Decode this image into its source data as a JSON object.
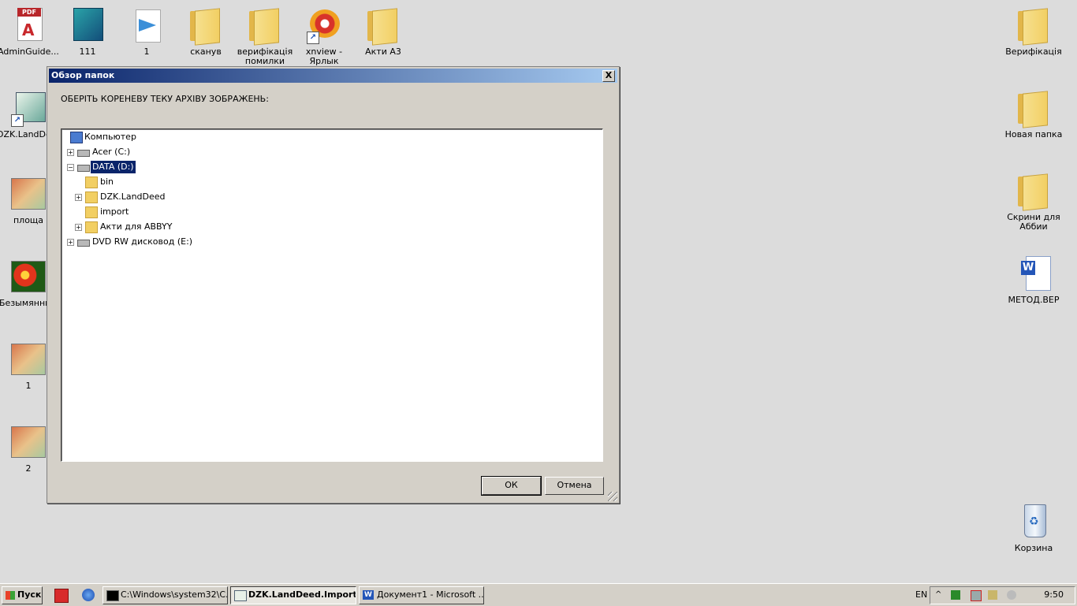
{
  "desktop": {
    "icons": [
      {
        "label": "AdminGuide...",
        "icon": "pdf-icon"
      },
      {
        "label": "111",
        "icon": "app-icon"
      },
      {
        "label": "1",
        "icon": "paper-plane-icon"
      },
      {
        "label": "сканув",
        "icon": "folder-icon"
      },
      {
        "label": "верифікація помилки",
        "icon": "folder-icon"
      },
      {
        "label": "xnview - Ярлык",
        "icon": "xnview-icon"
      },
      {
        "label": "Акти А3",
        "icon": "folder-icon"
      },
      {
        "label": "Верифікація",
        "icon": "folder-icon"
      },
      {
        "label": "DZK.LandDeed",
        "icon": "app-shortcut-icon"
      },
      {
        "label": "Новая папка",
        "icon": "folder-icon"
      },
      {
        "label": "площа",
        "icon": "image-icon"
      },
      {
        "label": "Скрини для Аббии",
        "icon": "folder-icon"
      },
      {
        "label": "Безымянный",
        "icon": "image-icon"
      },
      {
        "label": "МЕТОД.ВЕР",
        "icon": "word-document-icon"
      },
      {
        "label": "1",
        "icon": "image-icon"
      },
      {
        "label": "2",
        "icon": "image-icon"
      },
      {
        "label": "Корзина",
        "icon": "recycle-bin-icon"
      }
    ]
  },
  "dialog": {
    "title": "Обзор папок",
    "close_label": "X",
    "prompt": "ОБЕРІТЬ КОРЕНЕВУ ТЕКУ АРХІВУ ЗОБРАЖЕНЬ:",
    "tree": [
      {
        "label": "Компьютер",
        "icon": "computer-icon",
        "expander": ""
      },
      {
        "label": "Acer (C:)",
        "icon": "drive-icon",
        "expander": "+"
      },
      {
        "label": "DATA (D:)",
        "icon": "drive-icon",
        "expander": "−",
        "selected": true
      },
      {
        "label": "bin",
        "icon": "folder-icon",
        "expander": ""
      },
      {
        "label": "DZK.LandDeed",
        "icon": "folder-icon",
        "expander": "+"
      },
      {
        "label": "import",
        "icon": "folder-icon",
        "expander": ""
      },
      {
        "label": "Акти для ABBYY",
        "icon": "folder-icon",
        "expander": "+"
      },
      {
        "label": "DVD RW дисковод (E:)",
        "icon": "dvd-drive-icon",
        "expander": "+"
      }
    ],
    "ok_label": "ОК",
    "cancel_label": "Отмена"
  },
  "taskbar": {
    "start_label": "Пуск",
    "tasks": [
      {
        "label": "C:\\Windows\\system32\\C...",
        "active": false
      },
      {
        "label": "DZK.LandDeed.Import",
        "active": true
      },
      {
        "label": "Документ1 - Microsoft ...",
        "active": false
      }
    ],
    "language": "EN",
    "clock": "9:50"
  }
}
